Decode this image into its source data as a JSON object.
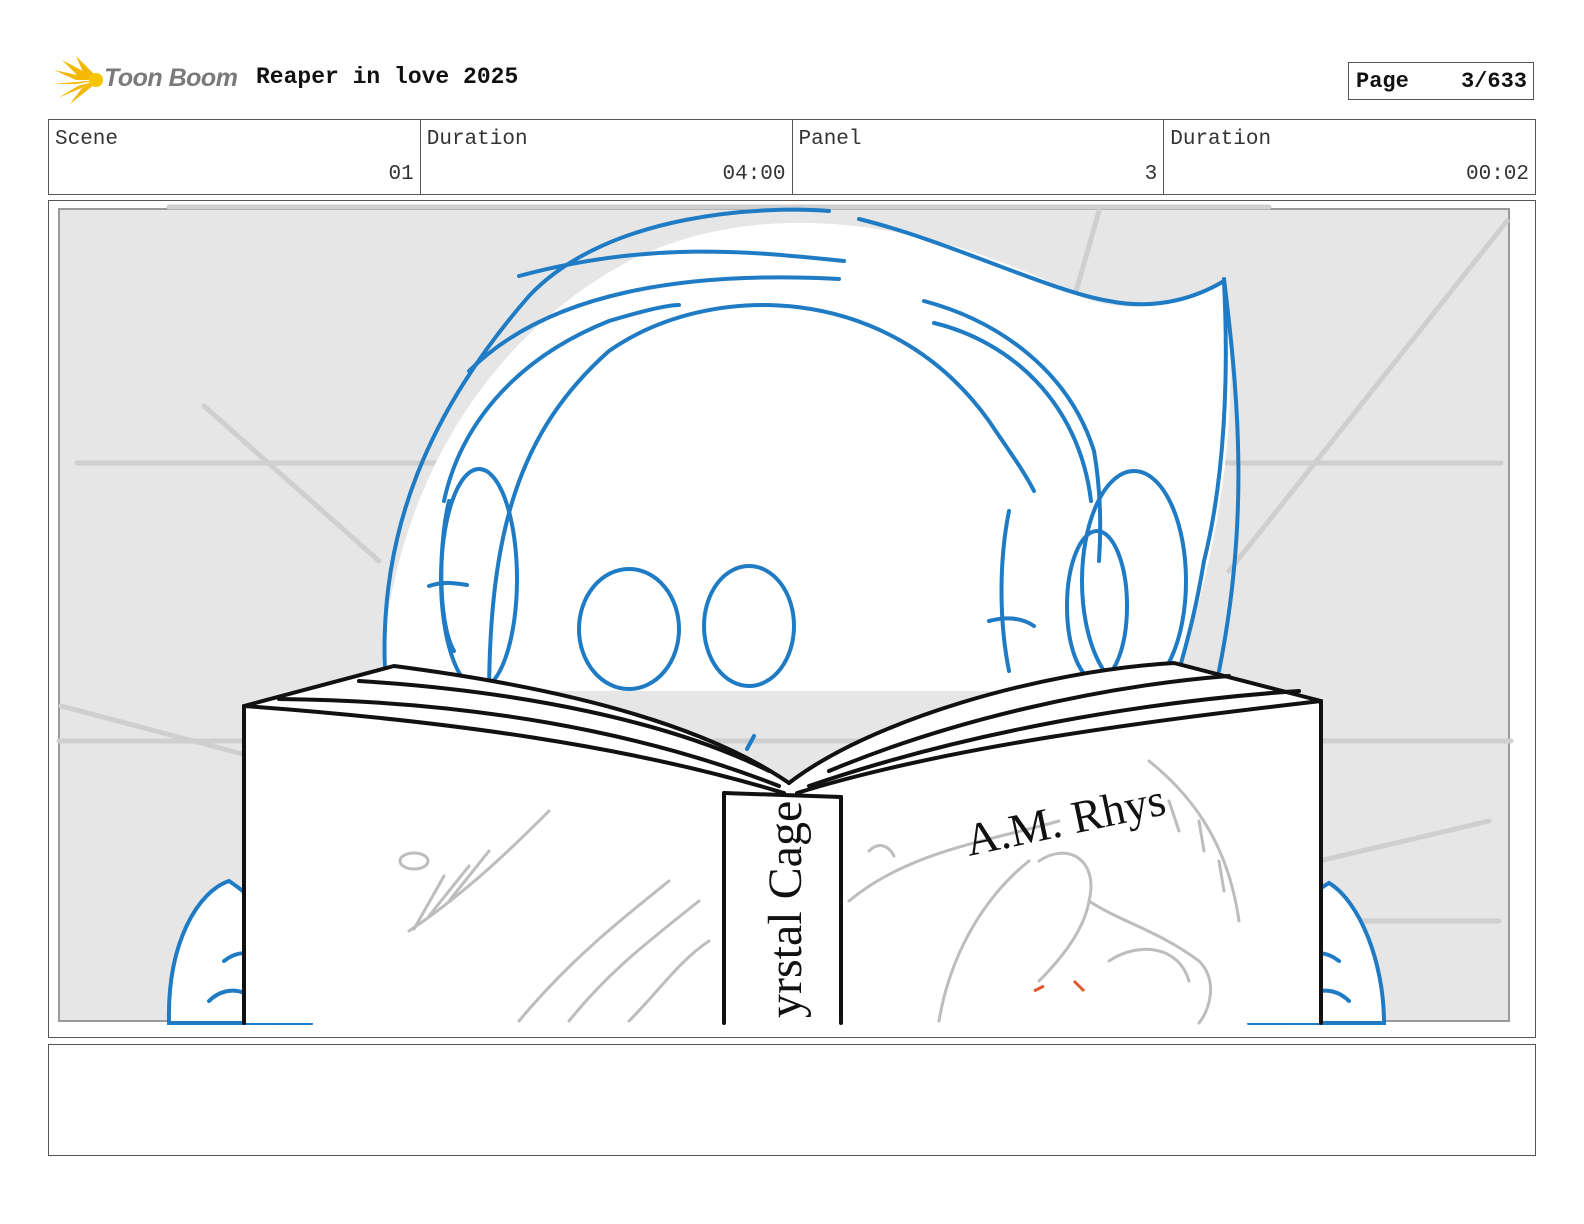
{
  "header": {
    "brand": "Toon Boom",
    "project_title": "Reaper in love 2025",
    "page_label": "Page",
    "page_value": "3/633"
  },
  "info": [
    {
      "label": "Scene",
      "value": "01"
    },
    {
      "label": "Duration",
      "value": "04:00"
    },
    {
      "label": "Panel",
      "value": "3"
    },
    {
      "label": "Duration",
      "value": "00:02"
    }
  ],
  "panel": {
    "book_spine_text": "yrstal Cage",
    "book_author": "A.M. Rhys",
    "colors": {
      "character_line": "#1e7bc4",
      "book_line": "#111111",
      "background_sketch": "#c8c8c8",
      "safe_area_fill": "#e6e6e6"
    }
  },
  "notes": {
    "text": ""
  },
  "icons": {
    "logo": "toon-boom-logo-icon"
  }
}
